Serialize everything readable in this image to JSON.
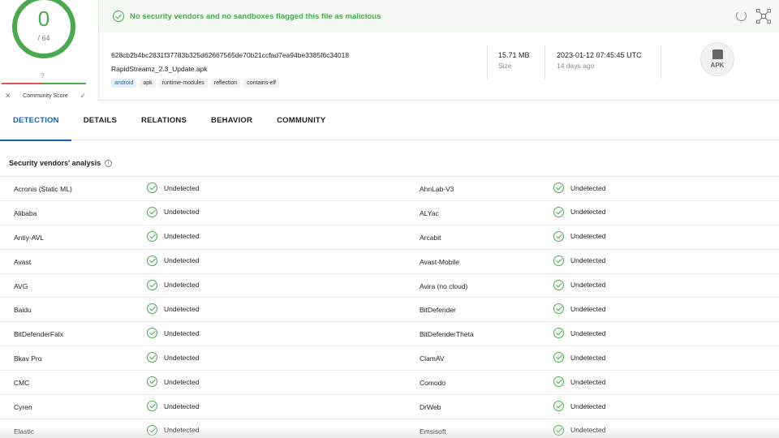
{
  "score": {
    "detections": "0",
    "total": "/ 64",
    "community_value": "?",
    "community_label": "Community Score"
  },
  "banner": {
    "text": "No security vendors and no sandboxes flagged this file as malicious"
  },
  "file": {
    "hash": "628cb2b4bc2831f37783b325d62667565de70b21ccfad7ea94be3385f6c34018",
    "name": "RapidStreamz_2.3_Update.apk",
    "tags": [
      "android",
      "apk",
      "runtime-modules",
      "reflection",
      "contains-elf"
    ],
    "size_value": "15.71 MB",
    "size_label": "Size",
    "date_value": "2023-01-12 07:45:45 UTC",
    "date_label": "14 days ago",
    "type_badge": "APK"
  },
  "tabs": [
    {
      "label": "DETECTION",
      "active": true
    },
    {
      "label": "DETAILS"
    },
    {
      "label": "RELATIONS"
    },
    {
      "label": "BEHAVIOR"
    },
    {
      "label": "COMMUNITY"
    }
  ],
  "vendors": {
    "title": "Security vendors' analysis",
    "rows": [
      {
        "left_name": "Acronis (Static ML)",
        "left_result": "Undetected",
        "right_name": "AhnLab-V3",
        "right_result": "Undetected"
      },
      {
        "left_name": "Alibaba",
        "left_result": "Undetected",
        "right_name": "ALYac",
        "right_result": "Undetected"
      },
      {
        "left_name": "Antiy-AVL",
        "left_result": "Undetected",
        "right_name": "Arcabit",
        "right_result": "Undetected"
      },
      {
        "left_name": "Avast",
        "left_result": "Undetected",
        "right_name": "Avast-Mobile",
        "right_result": "Undetected"
      },
      {
        "left_name": "AVG",
        "left_result": "Undetected",
        "right_name": "Avira (no cloud)",
        "right_result": "Undetected"
      },
      {
        "left_name": "Baidu",
        "left_result": "Undetected",
        "right_name": "BitDefender",
        "right_result": "Undetected"
      },
      {
        "left_name": "BitDefenderFalx",
        "left_result": "Undetected",
        "right_name": "BitDefenderTheta",
        "right_result": "Undetected"
      },
      {
        "left_name": "Bkav Pro",
        "left_result": "Undetected",
        "right_name": "ClamAV",
        "right_result": "Undetected"
      },
      {
        "left_name": "CMC",
        "left_result": "Undetected",
        "right_name": "Comodo",
        "right_result": "Undetected"
      },
      {
        "left_name": "Cyren",
        "left_result": "Undetected",
        "right_name": "DrWeb",
        "right_result": "Undetected"
      },
      {
        "left_name": "Elastic",
        "left_result": "Undetected",
        "right_name": "Emsisoft",
        "right_result": "Undetected"
      }
    ]
  },
  "icons": {
    "status_ok": "check-circle-icon",
    "reload": "reload-icon",
    "graph": "graph-icon",
    "info": "info-icon",
    "apk": "android-apk-icon"
  },
  "colors": {
    "clean": "#4aa84f",
    "malicious": "#e0524e",
    "accent": "#1a5fb4"
  }
}
